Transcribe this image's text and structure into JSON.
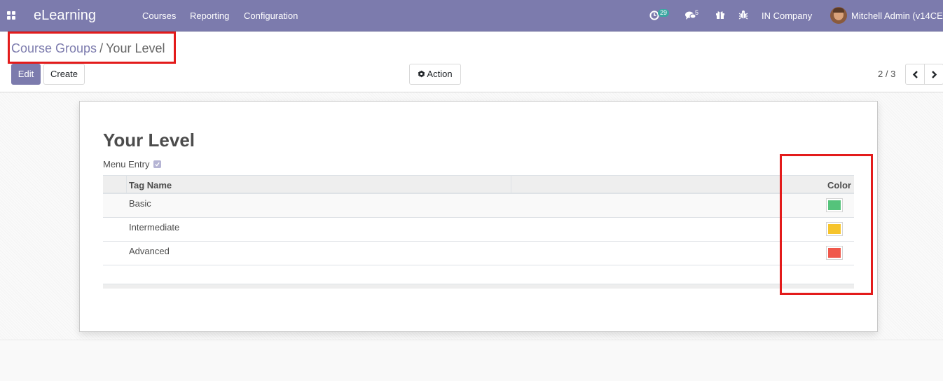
{
  "navbar": {
    "app_title": "eLearning",
    "menus": [
      "Courses",
      "Reporting",
      "Configuration"
    ],
    "activity_count": "29",
    "message_count": "5",
    "company": "IN Company",
    "user": "Mitchell Admin (v14CE"
  },
  "breadcrumb": {
    "parent": "Course Groups",
    "separator": "/",
    "current": "Your Level"
  },
  "buttons": {
    "edit": "Edit",
    "create": "Create",
    "action": "Action"
  },
  "pager": {
    "value": "2 / 3"
  },
  "form": {
    "title": "Your Level",
    "menu_entry_label": "Menu Entry",
    "menu_entry_checked": true,
    "columns": {
      "tag_name": "Tag Name",
      "color": "Color"
    },
    "rows": [
      {
        "name": "Basic",
        "color": "#55c37b"
      },
      {
        "name": "Intermediate",
        "color": "#f6c42c"
      },
      {
        "name": "Advanced",
        "color": "#f0584b"
      }
    ]
  },
  "colors": {
    "navbar": "#7c7bad",
    "primary": "#7c7bad",
    "highlight": "#e31b1b",
    "badge_activity": "#3aa6a1",
    "badge_message": "#7c7bad"
  }
}
